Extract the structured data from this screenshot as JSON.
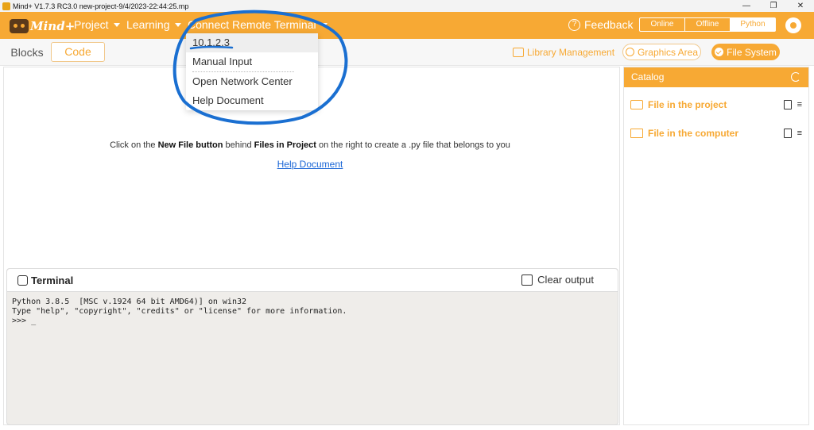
{
  "window": {
    "title": "Mind+ V1.7.3 RC3.0   new-project-9/4/2023-22:44:25.mp",
    "min_glyph": "—",
    "max_glyph": "❐",
    "close_glyph": "✕"
  },
  "menubar": {
    "brand": "Mind+",
    "project": "Project",
    "learning": "Learning",
    "connect": "Connect Remote Terminal",
    "feedback": "Feedback",
    "feedback_glyph": "?",
    "modes": [
      "Online",
      "Offline",
      "Python"
    ],
    "active_mode": "Python"
  },
  "toolbar": {
    "tab_blocks": "Blocks",
    "tab_code": "Code",
    "library": "Library Management",
    "graphics": "Graphics Area",
    "filesystem": "File System"
  },
  "workspace": {
    "hint_prefix": "Click on the ",
    "hint_bold1": "New File button",
    "hint_mid": " behind ",
    "hint_bold2": "Files in Project",
    "hint_suffix": " on the right to create a .py file that belongs to you",
    "help_link": "Help Document"
  },
  "terminal": {
    "title": "Terminal",
    "clear": "Clear output",
    "output": "Python 3.8.5  [MSC v.1924 64 bit AMD64)] on win32\nType \"help\", \"copyright\", \"credits\" or \"license\" for more information.\n>>> _"
  },
  "catalog": {
    "title": "Catalog",
    "rows": [
      {
        "label": "File in the project"
      },
      {
        "label": "File in the computer"
      }
    ],
    "menu_glyph": "≡"
  },
  "dropdown": {
    "items": [
      "10.1.2.3",
      "Manual Input",
      "Open Network Center",
      "Help Document"
    ]
  },
  "colors": {
    "accent": "#f7a934",
    "annotation": "#1a6fd1",
    "link": "#1a66d6"
  }
}
